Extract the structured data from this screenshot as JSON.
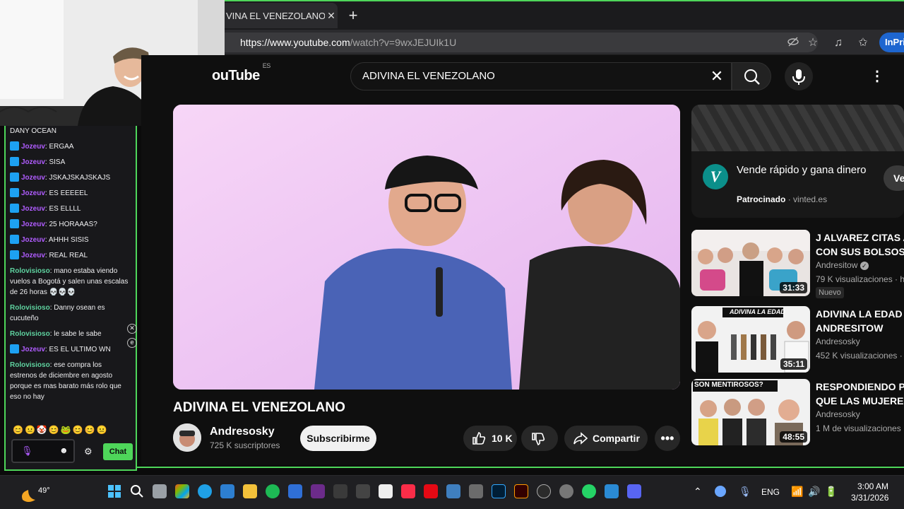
{
  "browser": {
    "tab_title": "VINA EL VENEZOLANO - Y",
    "url_host": "https://www.youtube.com",
    "url_path": "/watch?v=9wxJEJUIk1U",
    "inprivate_label": "InPriv"
  },
  "youtube": {
    "logo": "ouTube",
    "logo_region": "ES",
    "search_query": "ADIVINA EL VENEZOLANO",
    "video_title": "ADIVINA EL VENEZOLANO",
    "channel_name": "Andresosky",
    "channel_subs": "725 K suscriptores",
    "subscribe_label": "Subscribirme",
    "like_count": "10 K",
    "share_label": "Compartir",
    "ad": {
      "title": "Vende rápido y gana dinero",
      "sponsored_label": "Patrocinado",
      "sponsor_domain": "· vinted.es",
      "cta": "Ve"
    },
    "recommendations": [
      {
        "title_line1": "J ALVAREZ CITAS A",
        "title_line2": "CON SUS BOLSOS",
        "channel": "Andresitow",
        "views": "79 K visualizaciones · h",
        "duration": "31:33",
        "badge": "Nuevo"
      },
      {
        "title_line1": "ADIVINA LA EDAD -",
        "title_line2": "ANDRESITOW",
        "channel": "Andresosky",
        "views": "452 K visualizaciones ·",
        "duration": "35:11",
        "badge": ""
      },
      {
        "title_line1": "RESPONDIENDO PR",
        "title_line2": "QUE LAS MUJERES",
        "channel": "Andresosky",
        "views": "1 M de visualizaciones",
        "duration": "48:55",
        "badge": ""
      }
    ],
    "thumb_text_2": "ADIVINA LA EDAD",
    "thumb_text_3": "SON MENTIROSOS?"
  },
  "chat": {
    "messages": [
      {
        "user": "",
        "text": "DANY OCEAN",
        "prime": false,
        "color": "#efeff1"
      },
      {
        "user": "Jozeuv",
        "text": ": ERGAA",
        "prime": true,
        "color": "#b05cff"
      },
      {
        "user": "Jozeuv",
        "text": ": SISA",
        "prime": true,
        "color": "#b05cff"
      },
      {
        "user": "Jozeuv",
        "text": ": JSKAJSKAJSKAJS",
        "prime": true,
        "color": "#b05cff"
      },
      {
        "user": "Jozeuv",
        "text": ": ES EEEEEL",
        "prime": true,
        "color": "#b05cff"
      },
      {
        "user": "Jozeuv",
        "text": ": ES ELLLL",
        "prime": true,
        "color": "#b05cff"
      },
      {
        "user": "Jozeuv",
        "text": ": 25 HORAAAS?",
        "prime": true,
        "color": "#b05cff"
      },
      {
        "user": "Jozeuv",
        "text": ": AHHH SISIS",
        "prime": true,
        "color": "#b05cff"
      },
      {
        "user": "Jozeuv",
        "text": ": REAL REAL",
        "prime": true,
        "color": "#b05cff"
      },
      {
        "user": "Rolovisioso",
        "text": ": mano estaba viendo vuelos a Bogotá y salen unas escalas de 26 horas 💀💀💀",
        "prime": false,
        "color": "#5fd3a0"
      },
      {
        "user": "Rolovisioso",
        "text": ": Danny osean es cucuteño",
        "prime": false,
        "color": "#5fd3a0"
      },
      {
        "user": "Rolovisioso",
        "text": ": le sabe le sabe",
        "prime": false,
        "color": "#5fd3a0"
      },
      {
        "user": "Jozeuv",
        "text": ": ES EL ULTIMO WN",
        "prime": true,
        "color": "#b05cff"
      },
      {
        "user": "Rolovisioso",
        "text": ": ese compra los estrenos de diciembre en agosto porque es mas barato más rolo que eso no hay",
        "prime": false,
        "color": "#5fd3a0"
      }
    ],
    "emotes": "😊😐🤡😊🐸😊😊😐",
    "chat_button": "Chat"
  },
  "taskbar": {
    "temperature": "49°",
    "language": "ENG",
    "time": "3:00 AM",
    "date": "3/31/2026"
  },
  "colors": {
    "accent_green": "#4ed65a",
    "inprivate_blue": "#1e66d0",
    "yt_bg": "#0f0f0f"
  }
}
